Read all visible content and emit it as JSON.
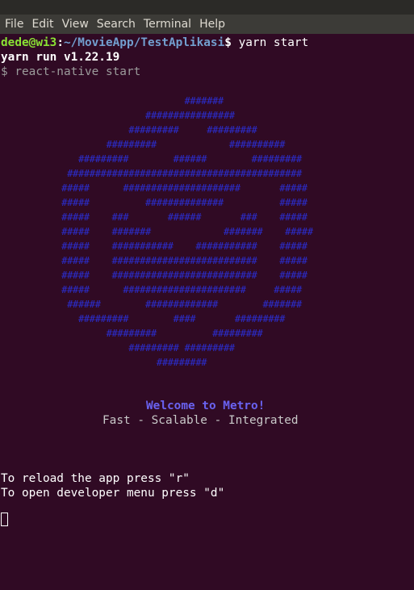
{
  "menubar": {
    "items": [
      "File",
      "Edit",
      "View",
      "Search",
      "Terminal",
      "Help"
    ]
  },
  "terminal": {
    "prompt_user": "dede@wi3",
    "prompt_sep": ":",
    "prompt_path": "~/MovieApp/TestAplikasi",
    "prompt_symbol": "$ ",
    "command": "yarn start",
    "yarn_version_line": "yarn run v1.22.19",
    "script_line": "$ react-native start",
    "logo": [
      "                                 #######",
      "                          ################",
      "                       #########     #########",
      "                   #########             ##########",
      "              #########        ######        #########",
      "            ##########################################",
      "           #####      #####################       #####",
      "           #####          ##############          #####",
      "           #####    ###       ######       ###    #####",
      "           #####    #######             #######    #####",
      "           #####    ###########    ###########    #####",
      "           #####    ##########################    #####",
      "           #####    ##########################    #####",
      "           #####      ######################     #####",
      "            ######        #############        #######",
      "              #########        ####       #########",
      "                   #########          #########",
      "                       ######### #########",
      "                            #########"
    ],
    "welcome_title": "Welcome to Metro!",
    "welcome_subtitle": "Fast - Scalable - Integrated",
    "hint_reload": "To reload the app press \"r\"",
    "hint_devmenu": "To open developer menu press \"d\""
  }
}
